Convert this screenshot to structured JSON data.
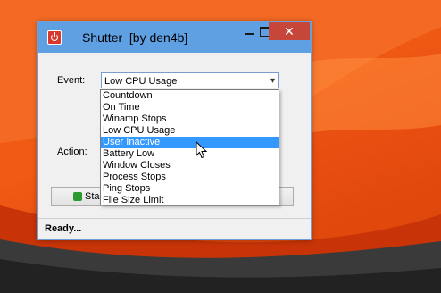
{
  "window": {
    "title": "Shutter  [by den4b]",
    "close_glyph": "✕"
  },
  "form": {
    "event_label": "Event:",
    "action_label": "Action:",
    "event_selected": "Low CPU Usage",
    "dropdown_arrow": "▾",
    "event_options": [
      "Countdown",
      "On Time",
      "Winamp Stops",
      "Low CPU Usage",
      "User Inactive",
      "Battery Low",
      "Window Closes",
      "Process Stops",
      "Ping Stops",
      "File Size Limit"
    ],
    "highlighted_option": "User Inactive",
    "start_label": "Sta"
  },
  "status": {
    "text": "Ready..."
  },
  "colors": {
    "titlebar": "#5fa0e2",
    "close_button": "#c7463a",
    "selection": "#3399ff",
    "desktop": "#f05a14"
  },
  "icons": [
    "app-power-icon",
    "minimize-icon",
    "maximize-icon",
    "close-icon",
    "dropdown-arrow-icon",
    "start-icon",
    "mouse-cursor-icon"
  ]
}
